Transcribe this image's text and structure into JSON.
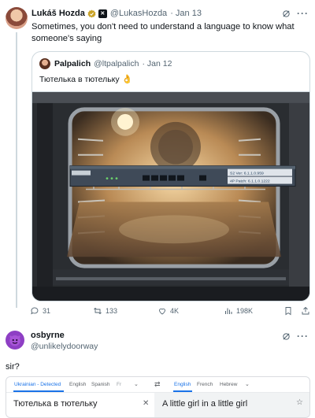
{
  "tweet": {
    "author_name": "Lukáš Hozda",
    "author_handle": "@LukasHozda",
    "date": "· Jan 13",
    "text": "Sometimes, you don't need to understand a language to know what someone's saying",
    "more_icon": "more-icon",
    "quote": {
      "author_name": "Palpalich",
      "author_handle": "@ltpalpalich",
      "date": "· Jan 12",
      "text": "Тютелька в тютельку",
      "emoji": "👌",
      "photo_description_icon": "oven-router-photo",
      "device_label_1": "S2 Ver: 6.1.1.0.959",
      "device_label_2": "4P Patch: 6.1.1.0.1222"
    },
    "stats": {
      "replies": "31",
      "retweets": "133",
      "likes": "4K",
      "views": "198K"
    }
  },
  "reply": {
    "author_name": "osbyrne",
    "author_handle": "@unlikelydoorway",
    "text": "sir?"
  },
  "translator": {
    "source_tabs": [
      "Ukrainian - Detected",
      "English",
      "Spanish",
      "Fr"
    ],
    "target_tabs": [
      "English",
      "French",
      "Hebrew"
    ],
    "source_text": "Тютелька в тютельку",
    "target_text": "A little girl in a little girl",
    "accent_color": "#1a73e8"
  }
}
